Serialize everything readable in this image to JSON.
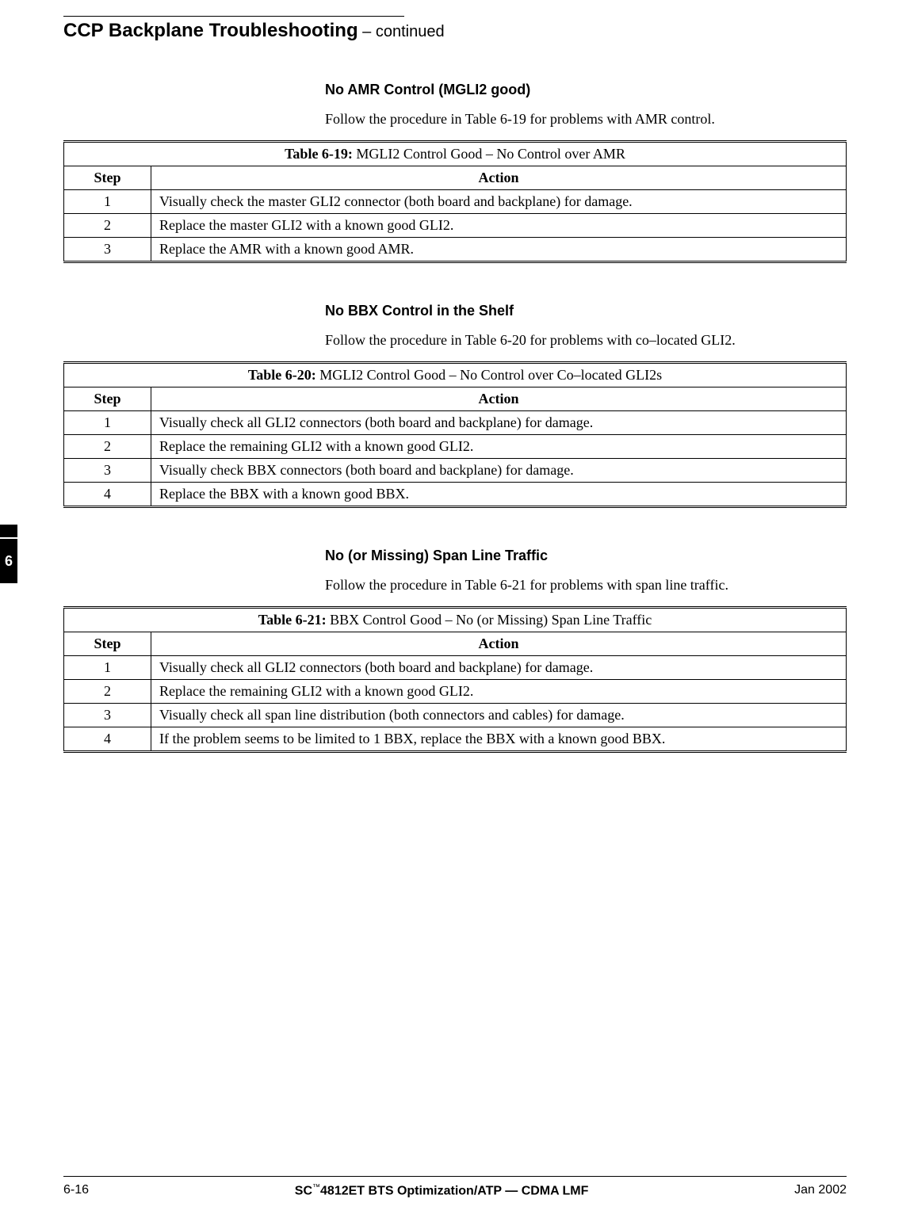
{
  "header": {
    "title_main": "CCP  Backplane Troubleshooting",
    "title_cont": " – continued"
  },
  "side_tab": "6",
  "sections": [
    {
      "heading": "No AMR Control (MGLI2 good)",
      "text": "Follow the procedure in Table 6-19 for problems with AMR control.",
      "table": {
        "label": "Table 6-19:",
        "caption": " MGLI2 Control Good – No Control over AMR",
        "col_step": "Step",
        "col_action": "Action",
        "rows": [
          {
            "step": "1",
            "action": "Visually check the master GLI2 connector (both board and backplane) for damage."
          },
          {
            "step": "2",
            "action": "Replace the master GLI2 with a known good GLI2."
          },
          {
            "step": "3",
            "action": "Replace the AMR with a known good AMR."
          }
        ]
      }
    },
    {
      "heading": "No BBX Control in the Shelf",
      "text": "Follow the procedure in Table 6-20 for problems with co–located GLI2.",
      "table": {
        "label": "Table 6-20:",
        "caption": " MGLI2 Control Good – No Control over Co–located GLI2s",
        "col_step": "Step",
        "col_action": "Action",
        "rows": [
          {
            "step": "1",
            "action": "Visually check all GLI2 connectors (both board and backplane) for damage."
          },
          {
            "step": "2",
            "action": "Replace the remaining GLI2 with a known good GLI2."
          },
          {
            "step": "3",
            "action": "Visually check BBX connectors (both board and backplane) for damage."
          },
          {
            "step": "4",
            "action": "Replace the BBX with a known good BBX."
          }
        ]
      }
    },
    {
      "heading": "No (or Missing) Span Line Traffic",
      "text": "Follow the procedure in Table 6-21 for problems with span line traffic.",
      "table": {
        "label": "Table 6-21:",
        "caption": " BBX Control Good – No (or Missing) Span Line Traffic",
        "col_step": "Step",
        "col_action": "Action",
        "rows": [
          {
            "step": "1",
            "action": "Visually check all GLI2 connectors (both board and backplane) for damage."
          },
          {
            "step": "2",
            "action": "Replace the remaining GLI2 with a known good GLI2."
          },
          {
            "step": "3",
            "action": "Visually check all span line distribution (both connectors and cables) for damage."
          },
          {
            "step": "4",
            "action": "If the problem seems to be limited to 1 BBX, replace the BBX with a known good BBX."
          }
        ]
      }
    }
  ],
  "footer": {
    "page_num": "6-16",
    "center_prefix": "SC",
    "center_tm": "™",
    "center_rest": "4812ET BTS Optimization/ATP — CDMA LMF",
    "date": "Jan 2002"
  }
}
